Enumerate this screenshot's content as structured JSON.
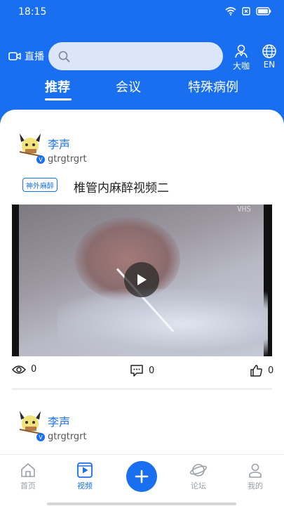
{
  "status": {
    "time": "18:15"
  },
  "header": {
    "live_label": "直播",
    "search_placeholder": "",
    "actions": [
      {
        "label": "大咖",
        "icon": "expert-icon"
      },
      {
        "label": "EN",
        "icon": "globe-icon"
      }
    ]
  },
  "tabs": [
    {
      "label": "推荐",
      "active": true
    },
    {
      "label": "会议",
      "active": false
    },
    {
      "label": "特殊病例",
      "active": false
    }
  ],
  "feed": [
    {
      "author": "李声",
      "user_id": "gtrgtrgrt",
      "tag": "神外麻醉",
      "title": "椎管内麻醉视频二",
      "video_watermark": "VHS",
      "views": "0",
      "comments": "0",
      "likes": "0"
    },
    {
      "author": "李声",
      "user_id": "gtrgtrgrt"
    }
  ],
  "bottom_nav": [
    {
      "label": "首页",
      "icon": "home-icon",
      "active": false
    },
    {
      "label": "视频",
      "icon": "video-icon",
      "active": true
    },
    {
      "label": "",
      "icon": "plus-icon",
      "active": false
    },
    {
      "label": "论坛",
      "icon": "forum-planet-icon",
      "active": false
    },
    {
      "label": "我的",
      "icon": "profile-icon",
      "active": false
    }
  ],
  "colors": {
    "brand": "#1a6ff0",
    "inactive": "#9aa0a6"
  }
}
